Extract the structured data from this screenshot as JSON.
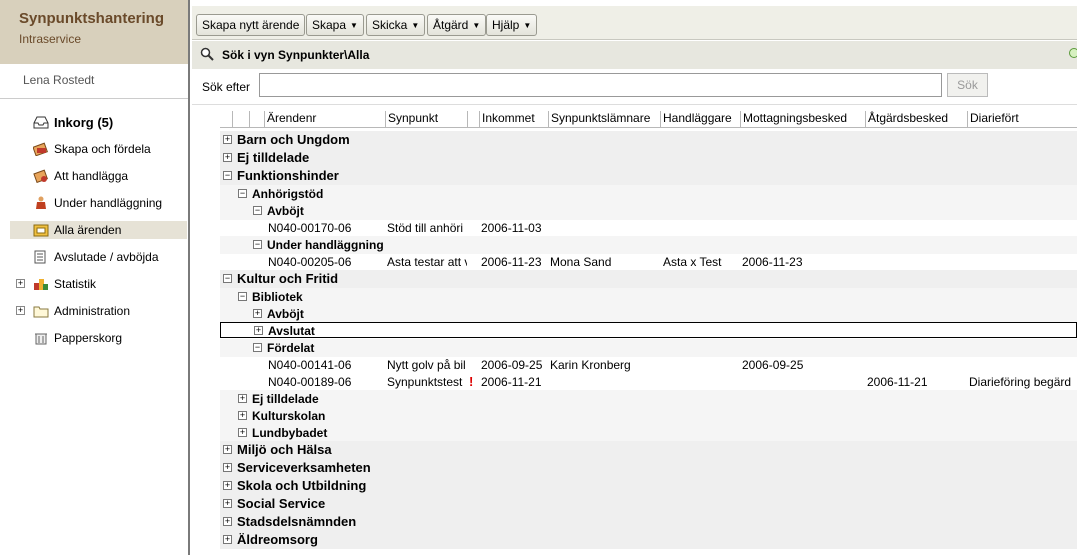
{
  "brand": {
    "title": "Synpunktshantering",
    "subtitle": "Intraservice"
  },
  "user": {
    "name": "Lena Rostedt"
  },
  "nav": [
    {
      "label": "Inkorg (5)",
      "icon": "inbox-icon",
      "bold": true
    },
    {
      "label": "Skapa och fördela",
      "icon": "create-distribute-icon"
    },
    {
      "label": "Att handlägga",
      "icon": "to-handle-icon"
    },
    {
      "label": "Under handläggning",
      "icon": "person-working-icon"
    },
    {
      "label": "Alla ärenden",
      "icon": "all-cases-icon",
      "selected": true
    },
    {
      "label": "Avslutade / avböjda",
      "icon": "closed-cases-icon"
    },
    {
      "label": "Statistik",
      "icon": "statistics-icon",
      "expandable": true
    },
    {
      "label": "Administration",
      "icon": "folder-icon",
      "expandable": true
    },
    {
      "label": "Papperskorg",
      "icon": "trash-icon"
    }
  ],
  "toolbar": {
    "create_case": "Skapa nytt ärende",
    "create": "Skapa",
    "send": "Skicka",
    "action": "Åtgärd",
    "help": "Hjälp"
  },
  "view": {
    "title": "Sök i vyn Synpunkter\\Alla"
  },
  "search": {
    "label": "Sök efter",
    "value": "",
    "placeholder": "",
    "button": "Sök"
  },
  "columns": [
    "Ärendenr",
    "Synpunkt",
    "Inkommet",
    "Synpunktslämnare",
    "Handläggare",
    "Mottagningsbesked",
    "Åtgärdsbesked",
    "Diariefört"
  ],
  "rows": [
    {
      "type": "group",
      "level": 1,
      "label": "Barn och Ungdom",
      "expanded": false
    },
    {
      "type": "group",
      "level": 1,
      "label": "Ej tilldelade",
      "expanded": false
    },
    {
      "type": "group",
      "level": 1,
      "label": "Funktionshinder",
      "expanded": true
    },
    {
      "type": "group",
      "level": 2,
      "label": "Anhörigstöd",
      "expanded": true
    },
    {
      "type": "group",
      "level": 3,
      "label": "Avböjt",
      "expanded": true
    },
    {
      "type": "data",
      "values": [
        "N040-00170-06",
        "Stöd till anhöri",
        "2006-11-03",
        "",
        "",
        "",
        "",
        ""
      ]
    },
    {
      "type": "group",
      "level": 3,
      "label": "Under handläggning",
      "expanded": true
    },
    {
      "type": "data",
      "values": [
        "N040-00205-06",
        "Asta testar att v",
        "2006-11-23",
        "Mona Sand",
        "Asta x Test",
        "2006-11-23",
        "",
        ""
      ]
    },
    {
      "type": "group",
      "level": 1,
      "label": "Kultur och Fritid",
      "expanded": true
    },
    {
      "type": "group",
      "level": 2,
      "label": "Bibliotek",
      "expanded": true
    },
    {
      "type": "group",
      "level": 3,
      "label": "Avböjt",
      "expanded": false
    },
    {
      "type": "group",
      "level": 3,
      "label": "Avslutat",
      "expanded": false,
      "selected": true
    },
    {
      "type": "group",
      "level": 3,
      "label": "Fördelat",
      "expanded": true
    },
    {
      "type": "data",
      "values": [
        "N040-00141-06",
        "Nytt golv på bil",
        "2006-09-25",
        "Karin Kronberg",
        "",
        "2006-09-25",
        "",
        ""
      ]
    },
    {
      "type": "data",
      "values": [
        "N040-00189-06",
        "Synpunktstest",
        "2006-11-21",
        "",
        "",
        "",
        "2006-11-21",
        "Diarieföring begärd"
      ],
      "flag": "!"
    },
    {
      "type": "group",
      "level": 2,
      "label": "Ej tilldelade",
      "expanded": false
    },
    {
      "type": "group",
      "level": 2,
      "label": "Kulturskolan",
      "expanded": false
    },
    {
      "type": "group",
      "level": 2,
      "label": "Lundbybadet",
      "expanded": false
    },
    {
      "type": "group",
      "level": 1,
      "label": "Miljö och Hälsa",
      "expanded": false
    },
    {
      "type": "group",
      "level": 1,
      "label": "Serviceverksamheten",
      "expanded": false
    },
    {
      "type": "group",
      "level": 1,
      "label": "Skola och Utbildning",
      "expanded": false
    },
    {
      "type": "group",
      "level": 1,
      "label": "Social Service",
      "expanded": false
    },
    {
      "type": "group",
      "level": 1,
      "label": "Stadsdelsnämnden",
      "expanded": false
    },
    {
      "type": "group",
      "level": 1,
      "label": "Äldreomsorg",
      "expanded": false
    }
  ],
  "colors": {
    "brand_bg": "#d8d0bc",
    "brand_text": "#6a4a2a",
    "toolbar_bg": "#efefe7",
    "selected_nav": "#e6e2d6"
  }
}
